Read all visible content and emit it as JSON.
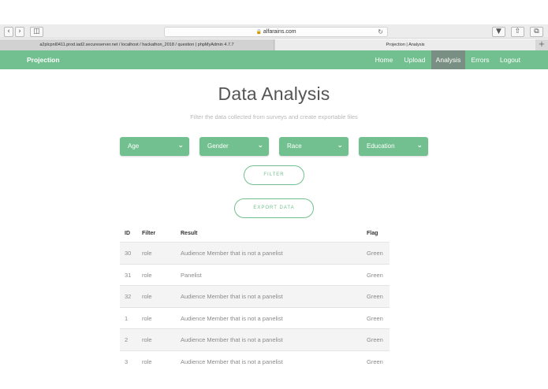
{
  "browser": {
    "url": "alfarains.com",
    "tabs": [
      {
        "title": "a2plcpnl0411.prod.iad2.secureserver.net / localhost / hackathon_2018 / question | phpMyAdmin 4.7.7"
      },
      {
        "title": "Projection | Analysis"
      }
    ]
  },
  "nav": {
    "brand": "Projection",
    "items": [
      {
        "label": "Home"
      },
      {
        "label": "Upload"
      },
      {
        "label": "Analysis"
      },
      {
        "label": "Errors"
      },
      {
        "label": "Logout"
      }
    ]
  },
  "page": {
    "title": "Data Analysis",
    "subtitle": "Filter the data collected from surveys and create exportable files"
  },
  "filters": {
    "dropdowns": [
      {
        "label": "Age"
      },
      {
        "label": "Gender"
      },
      {
        "label": "Race"
      },
      {
        "label": "Education"
      }
    ],
    "filter_label": "FILTER",
    "export_label": "EXPORT DATA"
  },
  "table": {
    "headers": {
      "id": "ID",
      "filter": "Filter",
      "result": "Result",
      "flag": "Flag"
    },
    "rows": [
      {
        "id": "30",
        "filter": "role",
        "result": "Audience Member that is not a panelist",
        "flag": "Green"
      },
      {
        "id": "31",
        "filter": "role",
        "result": "Panelist",
        "flag": "Green"
      },
      {
        "id": "32",
        "filter": "role",
        "result": "Audience Member that is not a panelist",
        "flag": "Green"
      },
      {
        "id": "1",
        "filter": "role",
        "result": "Audience Member that is not a panelist",
        "flag": "Green"
      },
      {
        "id": "2",
        "filter": "role",
        "result": "Audience Member that is not a panelist",
        "flag": "Green"
      },
      {
        "id": "3",
        "filter": "role",
        "result": "Audience Member that is not a panelist",
        "flag": "Green"
      }
    ]
  },
  "colors": {
    "accent": "#72c08f",
    "nav_active": "#7a8f83"
  }
}
